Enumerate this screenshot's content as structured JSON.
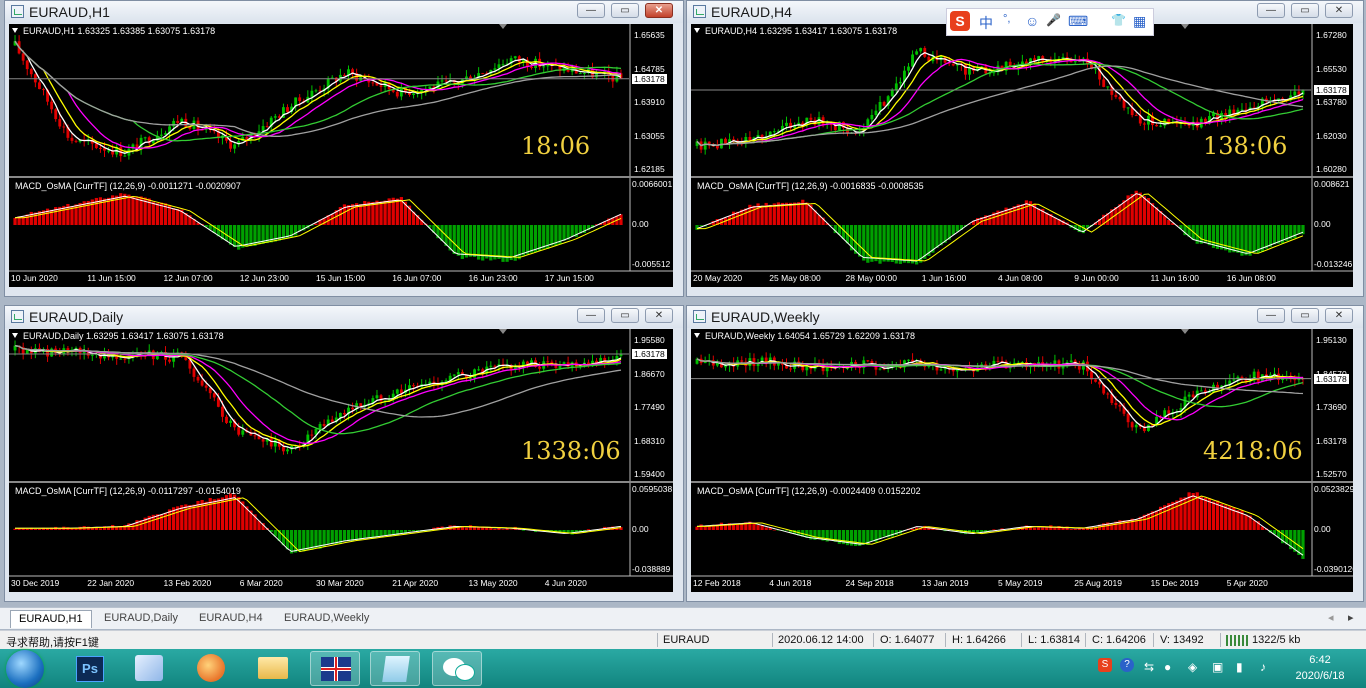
{
  "windows": [
    {
      "id": "h1",
      "title": "EURAUD,H1",
      "symbol_line": "EURAUD,H1  1.63325 1.63385 1.63075 1.63178",
      "macd_line": "MACD_OsMA [CurrTF] (12,26,9) -0.0011271 -0.0020907",
      "price_labels": [
        "1.65635",
        "1.64785",
        "1.63910",
        "1.63055",
        "1.62185"
      ],
      "current_price": "1.63178",
      "macd_labels": [
        "0.0066001",
        "0.00",
        "-0.005512"
      ],
      "time_labels": [
        "10 Jun 2020",
        "11 Jun 15:00",
        "12 Jun 07:00",
        "12 Jun 23:00",
        "15 Jun 15:00",
        "16 Jun 07:00",
        "16 Jun 23:00",
        "17 Jun 15:00"
      ],
      "timer": "18:06"
    },
    {
      "id": "h4",
      "title": "EURAUD,H4",
      "symbol_line": "EURAUD,H4  1.63295 1.63417 1.63075 1.63178",
      "macd_line": "MACD_OsMA [CurrTF] (12,26,9) -0.0016835 -0.0008535",
      "price_labels": [
        "1.67280",
        "1.65530",
        "1.63780",
        "1.62030",
        "1.60280"
      ],
      "current_price": "1.63178",
      "macd_labels": [
        "0.008621",
        "0.00",
        "-0.013246"
      ],
      "time_labels": [
        "20 May 2020",
        "25 May 08:00",
        "28 May 00:00",
        "1 Jun 16:00",
        "4 Jun 08:00",
        "9 Jun 00:00",
        "11 Jun 16:00",
        "16 Jun 08:00"
      ],
      "timer": "138:06"
    },
    {
      "id": "d1",
      "title": "EURAUD,Daily",
      "symbol_line": "EURAUD,Daily  1.63295 1.63417 1.63075 1.63178",
      "macd_line": "MACD_OsMA [CurrTF] (12,26,9) -0.0117297 -0.0154019",
      "price_labels": [
        "1.95580",
        "1.86670",
        "1.77490",
        "1.68310",
        "1.59400"
      ],
      "current_price": "1.63178",
      "macd_labels": [
        "0.0595038",
        "0.00",
        "-0.038889"
      ],
      "time_labels": [
        "30 Dec 2019",
        "22 Jan 2020",
        "13 Feb 2020",
        "6 Mar 2020",
        "30 Mar 2020",
        "21 Apr 2020",
        "13 May 2020",
        "4 Jun 2020"
      ],
      "timer": "1338:06"
    },
    {
      "id": "w1",
      "title": "EURAUD,Weekly",
      "symbol_line": "EURAUD,Weekly  1.64054 1.65729 1.62209 1.63178",
      "macd_line": "MACD_OsMA [CurrTF] (12,26,9) -0.0024409 0.0152202",
      "price_labels": [
        "1.95130",
        "1.84570",
        "1.73690",
        "1.63178",
        "1.52570"
      ],
      "current_price": "1.63178",
      "macd_labels": [
        "0.0523829",
        "0.00",
        "-0.0390126"
      ],
      "time_labels": [
        "12 Feb 2018",
        "4 Jun 2018",
        "24 Sep 2018",
        "13 Jan 2019",
        "5 May 2019",
        "25 Aug 2019",
        "15 Dec 2019",
        "5 Apr 2020"
      ],
      "timer": "4218:06"
    }
  ],
  "tabs": [
    "EURAUD,H1",
    "EURAUD,Daily",
    "EURAUD,H4",
    "EURAUD,Weekly"
  ],
  "active_tab": "EURAUD,H1",
  "status": {
    "help": "寻求帮助,请按F1键",
    "symbol": "EURAUD",
    "datetime": "2020.06.12 14:00",
    "open": "O: 1.64077",
    "high": "H: 1.64266",
    "low": "L: 1.63814",
    "close": "C: 1.64206",
    "volume": "V: 13492",
    "traffic": "1322/5 kb"
  },
  "ime_glyphs": [
    "中",
    "°,",
    "☺",
    "🎤",
    "⌨",
    "👕",
    "▦"
  ],
  "clock": {
    "time": "6:42",
    "date": "2020/6/18"
  },
  "colors": {
    "bull": "#00c000",
    "bear": "#e00000",
    "ma_white": "#ffffff",
    "ma_yellow": "#ffff00",
    "ma_magenta": "#ff00ff",
    "ma_green": "#33cc33",
    "ma_gray": "#a0a0a0",
    "timer": "#f0d040"
  }
}
